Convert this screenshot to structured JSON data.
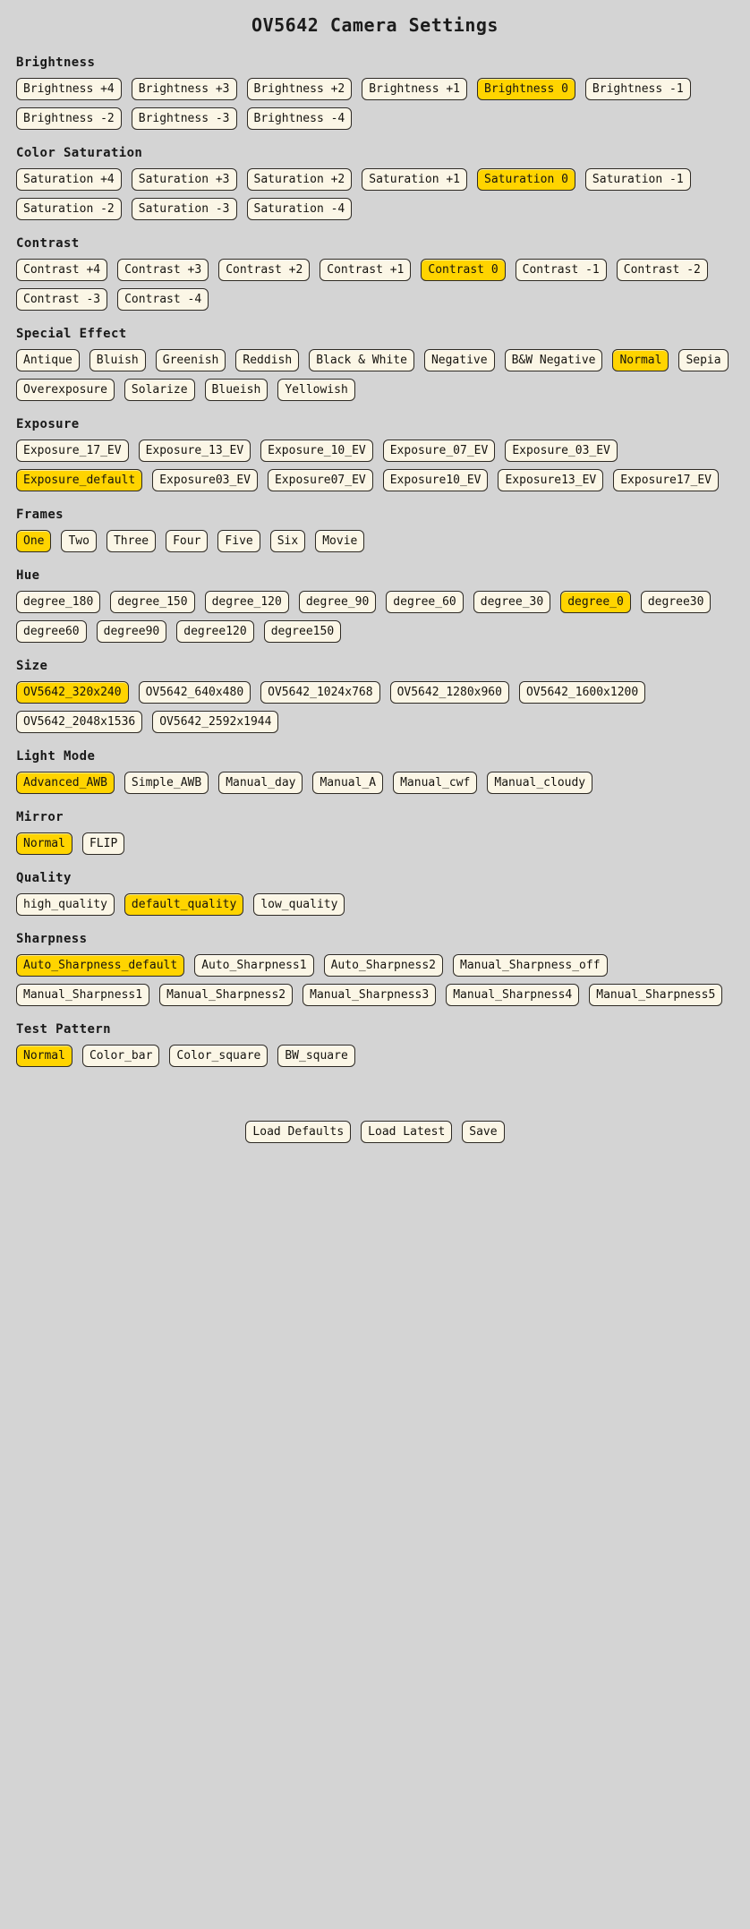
{
  "page": {
    "title": "OV5642 Camera Settings",
    "background_color": "#d4d4d4",
    "button_color": "#fbf6e6",
    "selected_color": "#ffd400",
    "border_color": "#2e2a24"
  },
  "sections": [
    {
      "id": "brightness",
      "title": "Brightness",
      "buttons": [
        {
          "label": "Brightness +4",
          "selected": false
        },
        {
          "label": "Brightness +3",
          "selected": false
        },
        {
          "label": "Brightness +2",
          "selected": false
        },
        {
          "label": "Brightness +1",
          "selected": false
        },
        {
          "label": "Brightness 0",
          "selected": true
        },
        {
          "label": "Brightness -1",
          "selected": false
        },
        {
          "label": "Brightness -2",
          "selected": false
        },
        {
          "label": "Brightness -3",
          "selected": false
        },
        {
          "label": "Brightness -4",
          "selected": false
        }
      ]
    },
    {
      "id": "color-saturation",
      "title": "Color Saturation",
      "buttons": [
        {
          "label": "Saturation +4",
          "selected": false
        },
        {
          "label": "Saturation +3",
          "selected": false
        },
        {
          "label": "Saturation +2",
          "selected": false
        },
        {
          "label": "Saturation +1",
          "selected": false
        },
        {
          "label": "Saturation 0",
          "selected": true
        },
        {
          "label": "Saturation -1",
          "selected": false
        },
        {
          "label": "Saturation -2",
          "selected": false
        },
        {
          "label": "Saturation -3",
          "selected": false
        },
        {
          "label": "Saturation -4",
          "selected": false
        }
      ]
    },
    {
      "id": "contrast",
      "title": "Contrast",
      "buttons": [
        {
          "label": "Contrast +4",
          "selected": false
        },
        {
          "label": "Contrast +3",
          "selected": false
        },
        {
          "label": "Contrast +2",
          "selected": false
        },
        {
          "label": "Contrast +1",
          "selected": false
        },
        {
          "label": "Contrast 0",
          "selected": true
        },
        {
          "label": "Contrast -1",
          "selected": false
        },
        {
          "label": "Contrast -2",
          "selected": false
        },
        {
          "label": "Contrast -3",
          "selected": false
        },
        {
          "label": "Contrast -4",
          "selected": false
        }
      ]
    },
    {
      "id": "special-effect",
      "title": "Special Effect",
      "buttons": [
        {
          "label": "Antique",
          "selected": false
        },
        {
          "label": "Bluish",
          "selected": false
        },
        {
          "label": "Greenish",
          "selected": false
        },
        {
          "label": "Reddish",
          "selected": false
        },
        {
          "label": "Black & White",
          "selected": false
        },
        {
          "label": "Negative",
          "selected": false
        },
        {
          "label": "B&W Negative",
          "selected": false
        },
        {
          "label": "Normal",
          "selected": true
        },
        {
          "label": "Sepia",
          "selected": false
        },
        {
          "label": "Overexposure",
          "selected": false
        },
        {
          "label": "Solarize",
          "selected": false
        },
        {
          "label": "Blueish",
          "selected": false
        },
        {
          "label": "Yellowish",
          "selected": false
        }
      ]
    },
    {
      "id": "exposure",
      "title": "Exposure",
      "buttons": [
        {
          "label": "Exposure_17_EV",
          "selected": false
        },
        {
          "label": "Exposure_13_EV",
          "selected": false
        },
        {
          "label": "Exposure_10_EV",
          "selected": false
        },
        {
          "label": "Exposure_07_EV",
          "selected": false
        },
        {
          "label": "Exposure_03_EV",
          "selected": false
        },
        {
          "label": "Exposure_default",
          "selected": true
        },
        {
          "label": "Exposure03_EV",
          "selected": false
        },
        {
          "label": "Exposure07_EV",
          "selected": false
        },
        {
          "label": "Exposure10_EV",
          "selected": false
        },
        {
          "label": "Exposure13_EV",
          "selected": false
        },
        {
          "label": "Exposure17_EV",
          "selected": false
        }
      ]
    },
    {
      "id": "frames",
      "title": "Frames",
      "buttons": [
        {
          "label": "One",
          "selected": true
        },
        {
          "label": "Two",
          "selected": false
        },
        {
          "label": "Three",
          "selected": false
        },
        {
          "label": "Four",
          "selected": false
        },
        {
          "label": "Five",
          "selected": false
        },
        {
          "label": "Six",
          "selected": false
        },
        {
          "label": "Movie",
          "selected": false
        }
      ]
    },
    {
      "id": "hue",
      "title": "Hue",
      "buttons": [
        {
          "label": "degree_180",
          "selected": false
        },
        {
          "label": "degree_150",
          "selected": false
        },
        {
          "label": "degree_120",
          "selected": false
        },
        {
          "label": "degree_90",
          "selected": false
        },
        {
          "label": "degree_60",
          "selected": false
        },
        {
          "label": "degree_30",
          "selected": false
        },
        {
          "label": "degree_0",
          "selected": true
        },
        {
          "label": "degree30",
          "selected": false
        },
        {
          "label": "degree60",
          "selected": false
        },
        {
          "label": "degree90",
          "selected": false
        },
        {
          "label": "degree120",
          "selected": false
        },
        {
          "label": "degree150",
          "selected": false
        }
      ]
    },
    {
      "id": "size",
      "title": "Size",
      "buttons": [
        {
          "label": "OV5642_320x240",
          "selected": true
        },
        {
          "label": "OV5642_640x480",
          "selected": false
        },
        {
          "label": "OV5642_1024x768",
          "selected": false
        },
        {
          "label": "OV5642_1280x960",
          "selected": false
        },
        {
          "label": "OV5642_1600x1200",
          "selected": false
        },
        {
          "label": "OV5642_2048x1536",
          "selected": false
        },
        {
          "label": "OV5642_2592x1944",
          "selected": false
        }
      ]
    },
    {
      "id": "light-mode",
      "title": "Light Mode",
      "buttons": [
        {
          "label": "Advanced_AWB",
          "selected": true
        },
        {
          "label": "Simple_AWB",
          "selected": false
        },
        {
          "label": "Manual_day",
          "selected": false
        },
        {
          "label": "Manual_A",
          "selected": false
        },
        {
          "label": "Manual_cwf",
          "selected": false
        },
        {
          "label": "Manual_cloudy",
          "selected": false
        }
      ]
    },
    {
      "id": "mirror",
      "title": "Mirror",
      "buttons": [
        {
          "label": "Normal",
          "selected": true
        },
        {
          "label": "FLIP",
          "selected": false
        }
      ]
    },
    {
      "id": "quality",
      "title": "Quality",
      "buttons": [
        {
          "label": "high_quality",
          "selected": false
        },
        {
          "label": "default_quality",
          "selected": true
        },
        {
          "label": "low_quality",
          "selected": false
        }
      ]
    },
    {
      "id": "sharpness",
      "title": "Sharpness",
      "buttons": [
        {
          "label": "Auto_Sharpness_default",
          "selected": true
        },
        {
          "label": "Auto_Sharpness1",
          "selected": false
        },
        {
          "label": "Auto_Sharpness2",
          "selected": false
        },
        {
          "label": "Manual_Sharpness_off",
          "selected": false
        },
        {
          "label": "Manual_Sharpness1",
          "selected": false
        },
        {
          "label": "Manual_Sharpness2",
          "selected": false
        },
        {
          "label": "Manual_Sharpness3",
          "selected": false
        },
        {
          "label": "Manual_Sharpness4",
          "selected": false
        },
        {
          "label": "Manual_Sharpness5",
          "selected": false
        }
      ]
    },
    {
      "id": "test-pattern",
      "title": "Test Pattern",
      "buttons": [
        {
          "label": "Normal",
          "selected": true
        },
        {
          "label": "Color_bar",
          "selected": false
        },
        {
          "label": "Color_square",
          "selected": false
        },
        {
          "label": "BW_square",
          "selected": false
        }
      ]
    }
  ],
  "footer": {
    "buttons": [
      {
        "label": "Load Defaults"
      },
      {
        "label": "Load Latest"
      },
      {
        "label": "Save"
      }
    ]
  }
}
